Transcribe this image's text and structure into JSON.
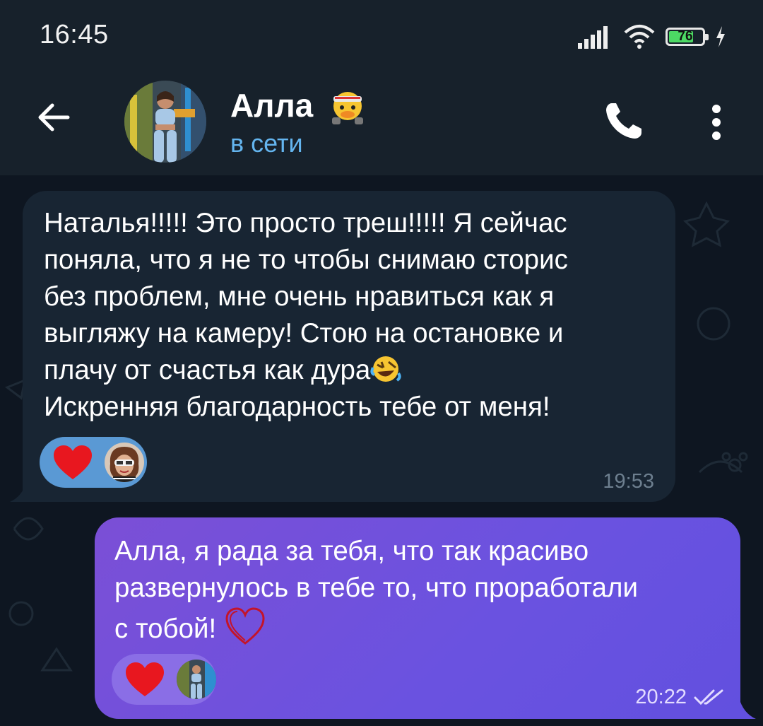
{
  "status_bar": {
    "time": "16:45",
    "battery": "76",
    "battery_level": 0.76,
    "icons": [
      "signal-icon",
      "wifi-icon",
      "battery-icon",
      "charging-icon"
    ]
  },
  "header": {
    "contact_name": "Алла",
    "status": "в сети",
    "colors": {
      "status": "#64b5ef",
      "header_bg": "#17212b"
    }
  },
  "messages": [
    {
      "direction": "incoming",
      "lines": [
        "Наталья!!!!! Это просто треш!!!!! Я сейчас",
        "поняла, что я не то чтобы снимаю сторис",
        "без проблем, мне очень нравиться как я",
        "выгляжу на камеру! Стою на остановке и",
        "плачу от счастья как дура",
        "Искренняя благодарность тебе от меня!"
      ],
      "inline_emoji": "rofl-emoji",
      "reaction": "red-heart",
      "time": "19:53"
    },
    {
      "direction": "outgoing",
      "lines": [
        "Алла, я рада за тебя, что так красиво",
        "развернулось в тебе то, что проработали",
        "с тобой!"
      ],
      "inline_emoji": "heart-outline-emoji",
      "reaction": "red-heart",
      "time": "20:22",
      "read": true
    }
  ],
  "colors": {
    "incoming_bubble": "#182533",
    "outgoing_bubble": "#6c52e0",
    "chat_bg": "#0e1621"
  }
}
